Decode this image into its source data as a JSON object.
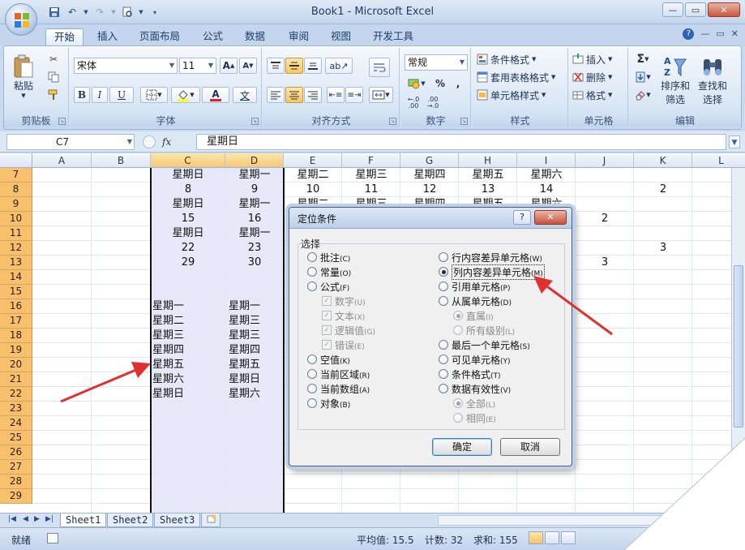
{
  "window": {
    "title": "Book1 - Microsoft Excel",
    "controls": {
      "minimize": "—",
      "restore": "▭",
      "close": "✕"
    }
  },
  "ribbon": {
    "tabs": [
      "开始",
      "插入",
      "页面布局",
      "公式",
      "数据",
      "审阅",
      "视图",
      "开发工具"
    ],
    "active_tab": "开始",
    "clipboard": {
      "paste": "粘贴",
      "label": "剪贴板"
    },
    "font": {
      "name": "宋体",
      "size": "11",
      "bold": "B",
      "italic": "I",
      "underline": "U",
      "font_color": "A",
      "phonetic": "文",
      "label": "字体"
    },
    "alignment": {
      "label": "对齐方式"
    },
    "number": {
      "format": "常规",
      "percent": "%",
      "comma": ",",
      "label": "数字"
    },
    "styles": {
      "conditional": "条件格式",
      "table": "套用表格格式",
      "cell": "单元格样式",
      "label": "样式"
    },
    "cells": {
      "insert": "插入",
      "delete": "删除",
      "format": "格式",
      "label": "单元格"
    },
    "editing": {
      "sort_filter_1": "排序和",
      "sort_filter_2": "筛选",
      "find_select_1": "查找和",
      "find_select_2": "选择",
      "sum": "Σ",
      "label": "编辑"
    }
  },
  "formula_bar": {
    "name_box": "C7",
    "fx": "fx",
    "value": "星期日"
  },
  "grid": {
    "columns": [
      "A",
      "B",
      "C",
      "D",
      "E",
      "F",
      "G",
      "H",
      "I",
      "J",
      "K",
      "L"
    ],
    "rows": [
      "7",
      "8",
      "9",
      "10",
      "11",
      "12",
      "13",
      "14",
      "15",
      "16",
      "17",
      "18",
      "19",
      "20",
      "21",
      "22",
      "23",
      "24",
      "25",
      "26",
      "27",
      "28",
      "29"
    ],
    "cells": {
      "C7": "星期日",
      "D7": "星期一",
      "E7": "星期二",
      "F7": "星期三",
      "G7": "星期四",
      "H7": "星期五",
      "I7": "星期六",
      "C8": "8",
      "D8": "9",
      "E8": "10",
      "F8": "11",
      "G8": "12",
      "H8": "13",
      "I8": "14",
      "K8": "2",
      "C9": "星期日",
      "D9": "星期一",
      "E9": "星期二",
      "F9": "星期三",
      "G9": "星期四",
      "H9": "星期五",
      "I9": "星期六",
      "C10": "15",
      "D10": "16",
      "J10": "2",
      "C11": "星期日",
      "D11": "星期一",
      "C12": "22",
      "D12": "23",
      "K12": "3",
      "C13": "29",
      "D13": "30",
      "J13": "3",
      "C16": "星期一",
      "D16": "星期一",
      "C17": "星期二",
      "D17": "星期三",
      "C18": "星期三",
      "D18": "星期三",
      "C19": "星期四",
      "D19": "星期四",
      "C20": "星期五",
      "D20": "星期五",
      "C21": "星期六",
      "D21": "星期日",
      "C22": "星期日",
      "D22": "星期六"
    }
  },
  "sheets": [
    "Sheet1",
    "Sheet2",
    "Sheet3"
  ],
  "active_sheet": "Sheet1",
  "status": {
    "ready": "就绪",
    "average": "平均值: 15.5",
    "count": "计数: 32",
    "sum": "求和: 155"
  },
  "dialog": {
    "title": "定位条件",
    "help": "?",
    "close": "✕",
    "group_label": "选择",
    "left_options": [
      {
        "label": "批注",
        "key": "(C)",
        "selected": false,
        "disabled": false
      },
      {
        "label": "常量",
        "key": "(O)",
        "selected": false,
        "disabled": false
      },
      {
        "label": "公式",
        "key": "(F)",
        "selected": false,
        "disabled": false
      },
      {
        "label": "数字",
        "key": "(U)",
        "type": "check",
        "disabled": true
      },
      {
        "label": "文本",
        "key": "(X)",
        "type": "check",
        "disabled": true
      },
      {
        "label": "逻辑值",
        "key": "(G)",
        "type": "check",
        "disabled": true
      },
      {
        "label": "错误",
        "key": "(E)",
        "type": "check",
        "disabled": true
      },
      {
        "label": "空值",
        "key": "(K)",
        "selected": false,
        "disabled": false
      },
      {
        "label": "当前区域",
        "key": "(R)",
        "selected": false,
        "disabled": false
      },
      {
        "label": "当前数组",
        "key": "(A)",
        "selected": false,
        "disabled": false
      },
      {
        "label": "对象",
        "key": "(B)",
        "selected": false,
        "disabled": false
      }
    ],
    "right_options": [
      {
        "label": "行内容差异单元格",
        "key": "(W)",
        "selected": false,
        "disabled": false
      },
      {
        "label": "列内容差异单元格",
        "key": "(M)",
        "selected": true,
        "disabled": false
      },
      {
        "label": "引用单元格",
        "key": "(P)",
        "selected": false,
        "disabled": false
      },
      {
        "label": "从属单元格",
        "key": "(D)",
        "selected": false,
        "disabled": false
      },
      {
        "label": "直属",
        "key": "(I)",
        "selected": true,
        "disabled": true
      },
      {
        "label": "所有级别",
        "key": "(L)",
        "selected": false,
        "disabled": true
      },
      {
        "label": "最后一个单元格",
        "key": "(S)",
        "selected": false,
        "disabled": false
      },
      {
        "label": "可见单元格",
        "key": "(Y)",
        "selected": false,
        "disabled": false
      },
      {
        "label": "条件格式",
        "key": "(T)",
        "selected": false,
        "disabled": false
      },
      {
        "label": "数据有效性",
        "key": "(V)",
        "selected": false,
        "disabled": false
      },
      {
        "label": "全部",
        "key": "(L)",
        "selected": true,
        "disabled": true
      },
      {
        "label": "相同",
        "key": "(E)",
        "selected": false,
        "disabled": true
      }
    ],
    "ok": "确定",
    "cancel": "取消"
  },
  "colors": {
    "annotation_arrow": "#e03030",
    "row_header": "#f8c06d",
    "selected_column": "#e8e9f8"
  }
}
